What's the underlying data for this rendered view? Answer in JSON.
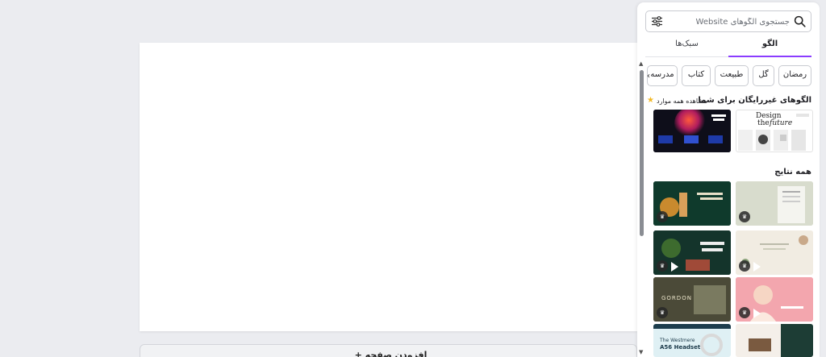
{
  "canvas": {
    "add_page_label": "افزودن صفحه",
    "add_page_icon": "+"
  },
  "panel": {
    "search": {
      "placeholder": "جستجوی الگوهای Website"
    },
    "tabs": [
      {
        "label": "الگو",
        "active": true
      },
      {
        "label": "سبک‌ها",
        "active": false
      }
    ],
    "chips": [
      "رمضان",
      "گل",
      "طبیعت",
      "کتاب",
      "مدرسه"
    ],
    "chips_more": "›",
    "free_section": {
      "title": "الگوهای غیررایگان برای شما",
      "see_all": "مشاهده همه موارد"
    },
    "results_title": "همه نتایج",
    "thumb_texts": {
      "design": "Design",
      "the": "the",
      "future": "future",
      "gordon": "GORDON",
      "westmere": "The Westmere",
      "headset": "A56 Headset"
    },
    "colors": {
      "accent": "#8b3dff",
      "star": "#f2b824"
    }
  }
}
